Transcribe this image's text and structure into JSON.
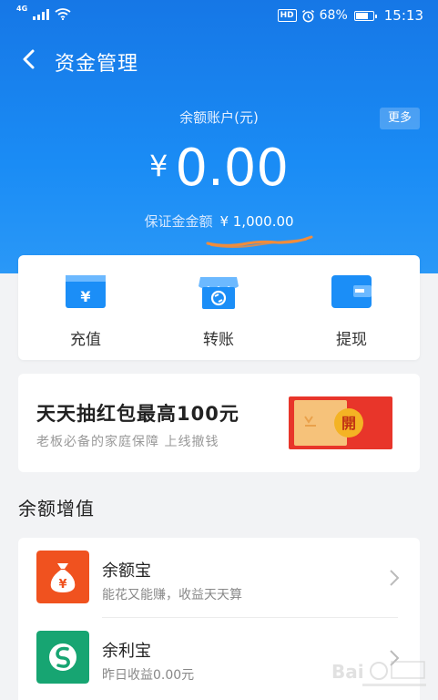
{
  "status_bar": {
    "network": "4G",
    "hd": "HD",
    "battery_percent": "68%",
    "time": "15:13",
    "battery_level": 0.68
  },
  "nav": {
    "title": "资金管理",
    "back_icon": "chevron-left-icon"
  },
  "balance": {
    "label": "余额账户(元)",
    "more": "更多",
    "currency": "¥",
    "amount": "0.00",
    "deposit_label": "保证金金额",
    "deposit_value": "¥ 1,000.00"
  },
  "actions": [
    {
      "label": "充值",
      "icon": "recharge-card-icon"
    },
    {
      "label": "转账",
      "icon": "transfer-shop-icon"
    },
    {
      "label": "提现",
      "icon": "wallet-icon"
    }
  ],
  "promo": {
    "title": "天天抽红包最高100元",
    "subtitle": "老板必备的家庭保障 上线撤钱",
    "packet_char": "開"
  },
  "section": {
    "title": "余额增值"
  },
  "products": [
    {
      "name": "余额宝",
      "desc": "能花又能赚，收益天天算",
      "icon": "money-bag-icon"
    },
    {
      "name": "余利宝",
      "desc": "昨日收益0.00元",
      "icon": "yulibao-icon"
    }
  ],
  "colors": {
    "header_blue": "#1a86f0",
    "orange_icon": "#f0521f",
    "green_icon": "#17a572",
    "annotation_orange": "#f28c3a",
    "red_packet": "#e8352a"
  }
}
